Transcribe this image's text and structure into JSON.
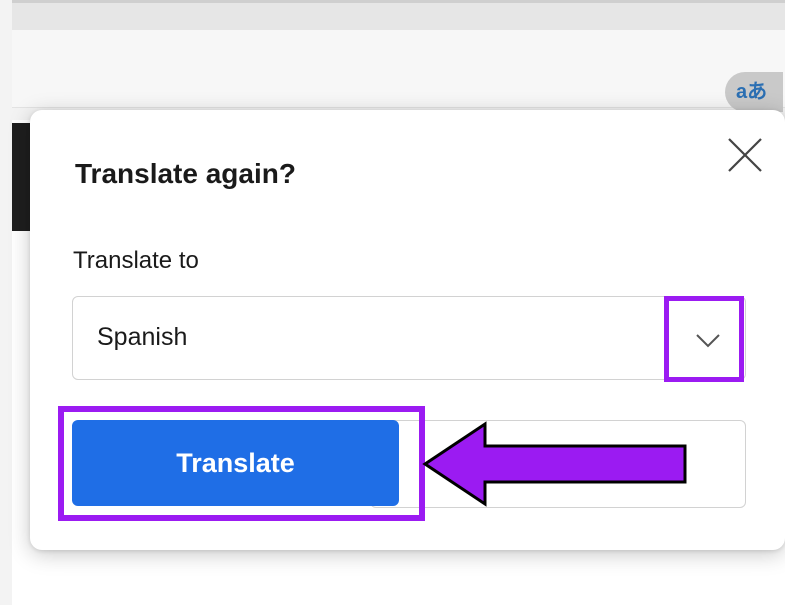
{
  "toolbar": {
    "translate_icon_text": "aあ"
  },
  "popup": {
    "title": "Translate again?",
    "field_label": "Translate to",
    "selected_language": "Spanish",
    "primary_button_label": "Translate",
    "secondary_button_label": ""
  },
  "icons": {
    "close": "close-icon",
    "dropdown": "chevron-down-icon",
    "translate": "translate-icon"
  },
  "colors": {
    "primary": "#1f6ee6",
    "highlight": "#9b1bf2",
    "arrow_fill": "#9b1bf2"
  }
}
